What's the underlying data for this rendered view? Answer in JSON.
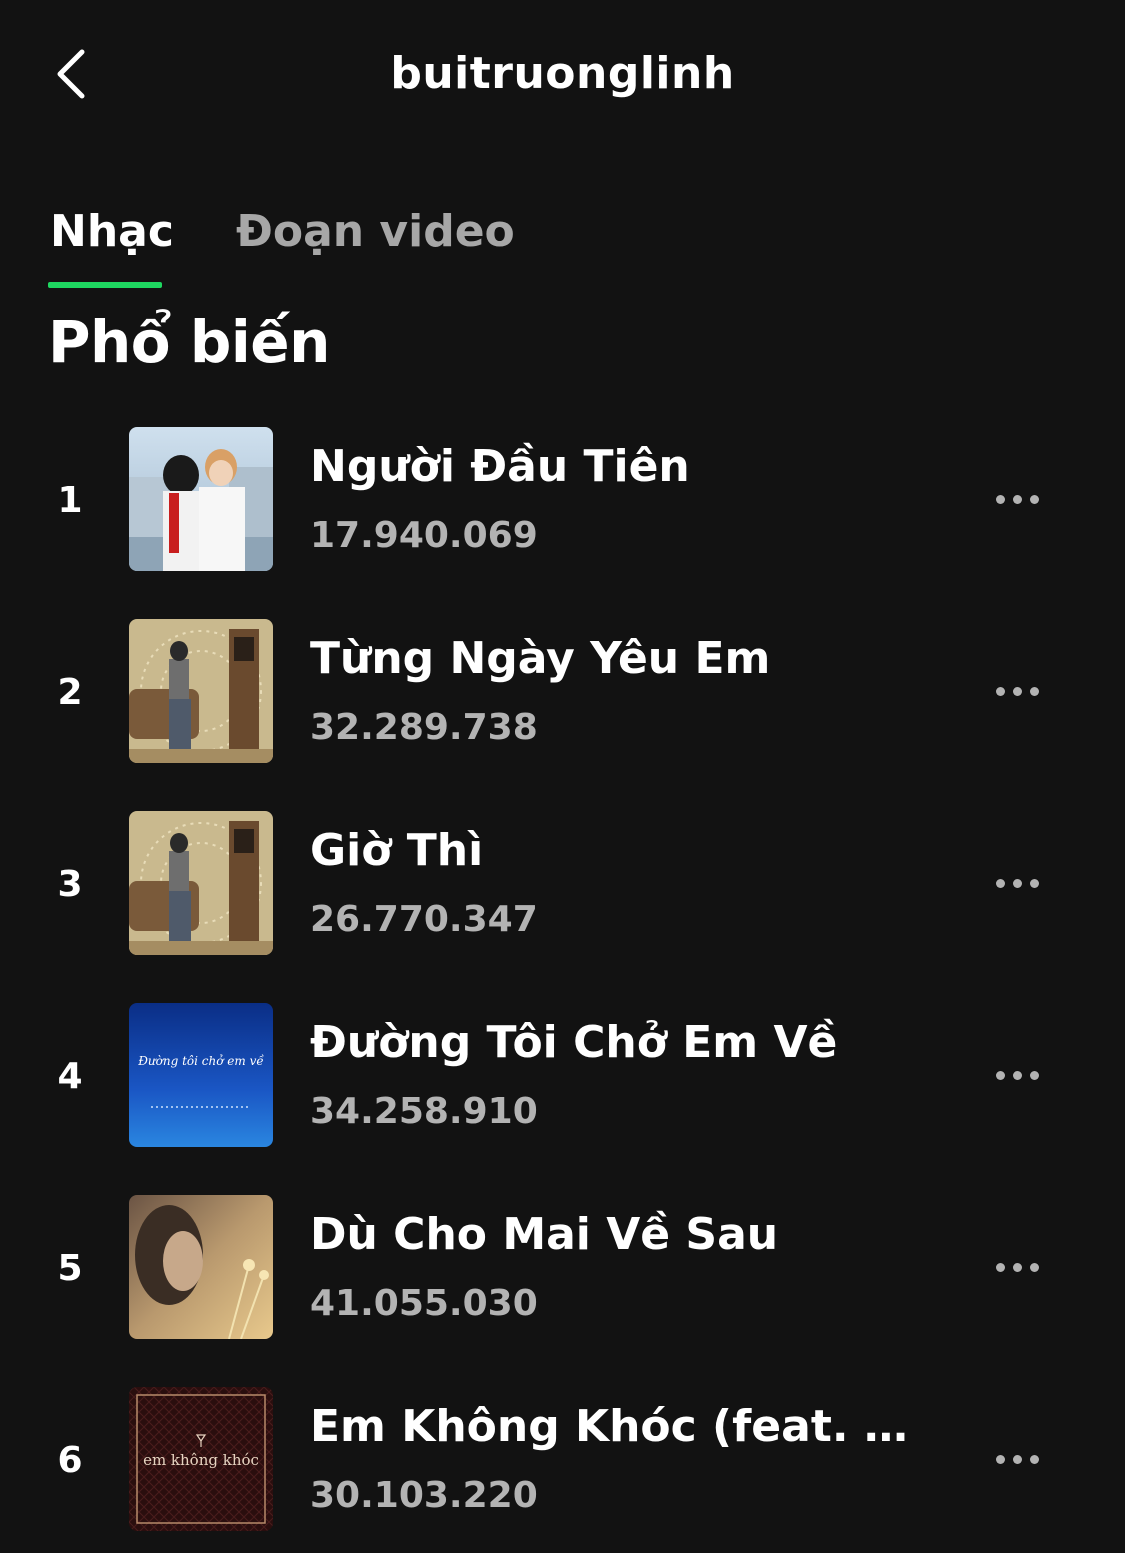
{
  "header": {
    "back_icon": "chevron-left-icon",
    "title": "buitruonglinh"
  },
  "tabs": [
    {
      "label": "Nhạc",
      "active": true
    },
    {
      "label": "Đoạn video",
      "active": false
    }
  ],
  "accent_color": "#1ed760",
  "section_title": "Phổ biến",
  "tracks": [
    {
      "rank": "1",
      "title": "Người Đầu Tiên",
      "plays": "17.940.069",
      "more_icon": "more-dots-icon"
    },
    {
      "rank": "2",
      "title": "Từng Ngày Yêu Em",
      "plays": "32.289.738",
      "more_icon": "more-dots-icon"
    },
    {
      "rank": "3",
      "title": "Giờ Thì",
      "plays": "26.770.347",
      "more_icon": "more-dots-icon"
    },
    {
      "rank": "4",
      "title": "Đường Tôi Chở Em Về",
      "plays": "34.258.910",
      "more_icon": "more-dots-icon",
      "cover_text": "Đường tôi chở em về"
    },
    {
      "rank": "5",
      "title": "Dù Cho Mai Về Sau",
      "plays": "41.055.030",
      "more_icon": "more-dots-icon"
    },
    {
      "rank": "6",
      "title": "Em Không Khóc (feat. Vũ P...",
      "plays": "30.103.220",
      "more_icon": "more-dots-icon",
      "cover_text": "em không khóc"
    }
  ]
}
